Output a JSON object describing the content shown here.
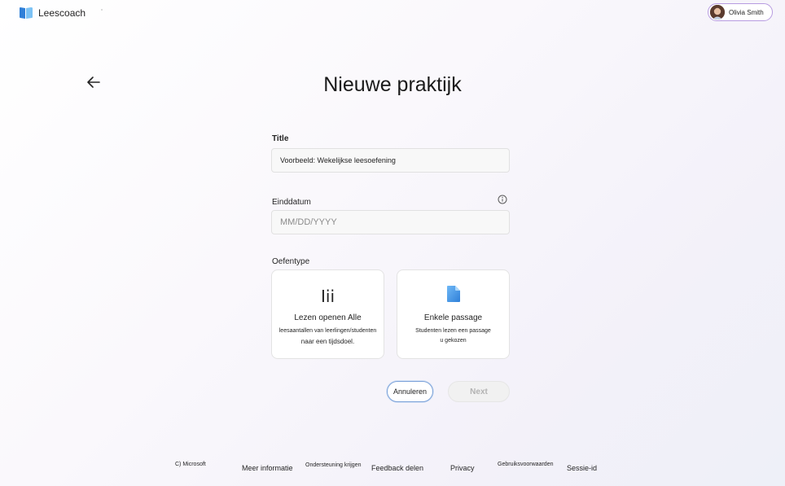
{
  "app": {
    "name": "Leescoach",
    "logo_icon": "book-logo-icon",
    "colors": {
      "logo_blue": "#2f7fd8",
      "logo_light": "#7cc2f5",
      "accent_border": "#b79be0",
      "cancel_border": "#7aa0d8"
    }
  },
  "user": {
    "name": "Olivia Smith",
    "avatar_icon": "user-avatar"
  },
  "page": {
    "title": "Nieuwe praktijk",
    "back_icon": "arrow-left-icon"
  },
  "form": {
    "title_label": "Title",
    "title_value": "Voorbeeld: Wekelijkse leesoefening",
    "due_label": "Einddatum",
    "due_placeholder": "MM/DD/YYYY",
    "info_icon": "info-icon",
    "type_label": "Oefentype",
    "types": [
      {
        "glyph": "Iii",
        "title": "Lezen openen Alle",
        "desc_line1": "leesaantallen van leerlingen/studenten",
        "desc_line2": "naar een tijdsdoel.",
        "icon": "books-icon"
      },
      {
        "title": "Enkele passage",
        "desc_line1": "Studenten lezen een passage",
        "desc_line2": "u gekozen",
        "icon": "document-icon"
      }
    ]
  },
  "actions": {
    "cancel": "Annuleren",
    "next": "Next"
  },
  "footer": {
    "copyright": "C) Microsoft",
    "links": [
      "Meer informatie",
      "Ondersteuning krijgen",
      "Feedback delen",
      "Privacy",
      "Gebruiksvoorwaarden",
      "Sessie-id"
    ]
  }
}
